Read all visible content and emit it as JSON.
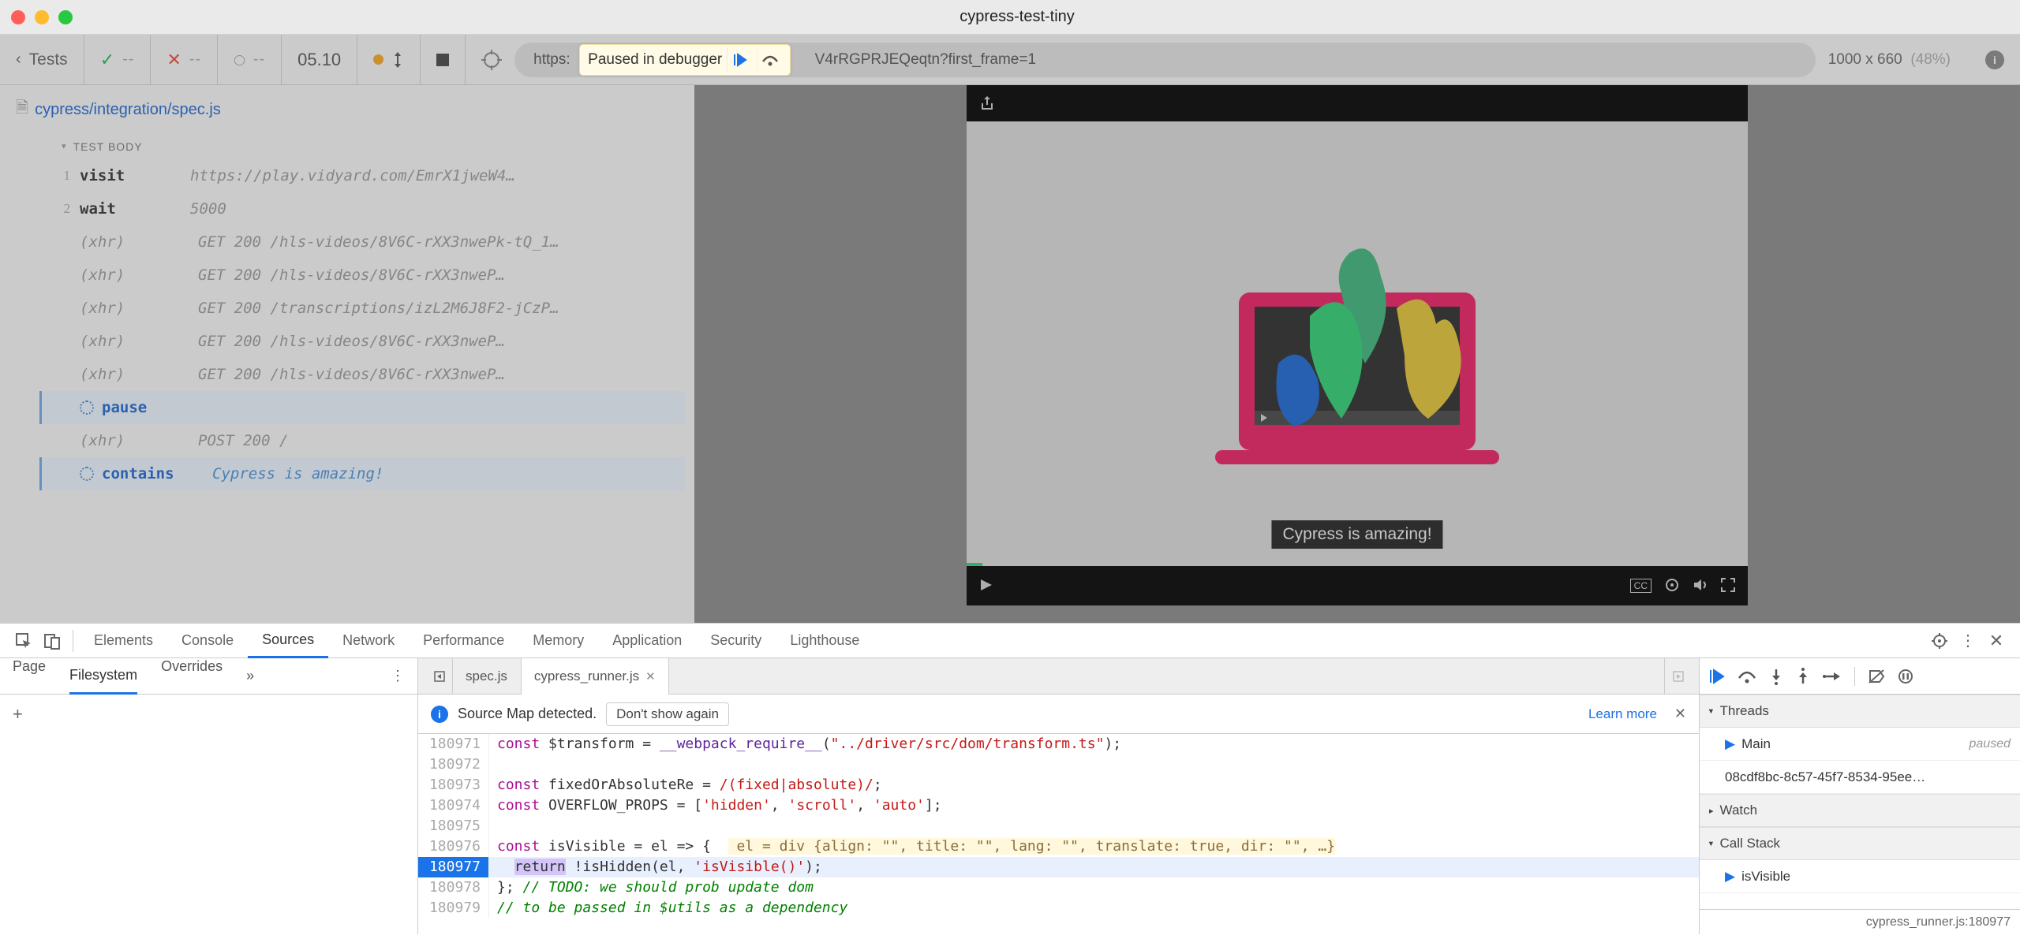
{
  "window": {
    "title": "cypress-test-tiny"
  },
  "toolbar": {
    "back_label": "Tests",
    "pass": "--",
    "fail": "--",
    "pending": "--",
    "timer": "05.10",
    "paused_label": "Paused in debugger",
    "url_prefix": "https:",
    "url_suffix": "V4rRGPRJEQeqtn?first_frame=1",
    "viewport": "1000 x 660",
    "viewport_pct": "(48%)"
  },
  "spec": {
    "path": "cypress/integration/spec.js",
    "test_body_label": "TEST BODY"
  },
  "commands": [
    {
      "num": "1",
      "name": "visit",
      "type": "cmd",
      "msg": "https://play.vidyard.com/EmrX1jweW4…"
    },
    {
      "num": "2",
      "name": "wait",
      "type": "cmd",
      "msg": "5000"
    },
    {
      "num": "",
      "name": "(xhr)",
      "type": "xhr",
      "dot": true,
      "msg": "GET 200 /hls-videos/8V6C-rXX3nwePk-tQ_1…"
    },
    {
      "num": "",
      "name": "(xhr)",
      "type": "xhr",
      "dot": true,
      "msg": "GET 200 /hls-videos/8V6C-rXX3nweP…"
    },
    {
      "num": "",
      "name": "(xhr)",
      "type": "xhr",
      "dot": true,
      "msg": "GET 200 /transcriptions/izL2M6J8F2-jCzP…"
    },
    {
      "num": "",
      "name": "(xhr)",
      "type": "xhr",
      "dot": true,
      "msg": "GET 200 /hls-videos/8V6C-rXX3nweP…"
    },
    {
      "num": "",
      "name": "(xhr)",
      "type": "xhr",
      "dot": true,
      "msg": "GET 200 /hls-videos/8V6C-rXX3nweP…"
    },
    {
      "num": "",
      "name": "pause",
      "type": "blue",
      "spin": true,
      "msg": "",
      "active": true
    },
    {
      "num": "",
      "name": "(xhr)",
      "type": "xhr",
      "dot": true,
      "msg": "POST 200 /"
    },
    {
      "num": "",
      "name": "contains",
      "type": "blue",
      "spin": true,
      "msg": "Cypress is amazing!",
      "msgblue": true,
      "active": true
    }
  ],
  "video": {
    "subtitle": "Cypress is amazing!"
  },
  "devtools": {
    "main_tabs": [
      "Elements",
      "Console",
      "Sources",
      "Network",
      "Performance",
      "Memory",
      "Application",
      "Security",
      "Lighthouse"
    ],
    "main_active": "Sources",
    "nav_subtabs": [
      "Page",
      "Filesystem",
      "Overrides"
    ],
    "nav_active": "Filesystem",
    "nav_more": "»",
    "code_tabs": [
      {
        "label": "spec.js",
        "active": false
      },
      {
        "label": "cypress_runner.js",
        "active": true,
        "closeable": true
      }
    ],
    "src_info": "Source Map detected.",
    "dont_show": "Don't show again",
    "learn_more": "Learn more",
    "code_lines": [
      {
        "n": "180971",
        "html": "<span class='kw'>const</span> $transform = <span class='fn'>__webpack_require__</span>(<span class='str'>\"../driver/src/dom/transform.ts\"</span>);"
      },
      {
        "n": "180972",
        "html": ""
      },
      {
        "n": "180973",
        "html": "<span class='kw'>const</span> fixedOrAbsoluteRe = <span class='str'>/(fixed|absolute)/</span>;"
      },
      {
        "n": "180974",
        "html": "<span class='kw'>const</span> OVERFLOW_PROPS = [<span class='str'>'hidden'</span>, <span class='str'>'scroll'</span>, <span class='str'>'auto'</span>];"
      },
      {
        "n": "180975",
        "html": ""
      },
      {
        "n": "180976",
        "html": "<span class='kw'>const</span> isVisible = el =&gt; {  <span class='inline-obj'> el = div {align: \"\", title: \"\", lang: \"\", translate: true, dir: \"\", …}</span>"
      },
      {
        "n": "180977",
        "html": "  <span class='ret-hl'>return</span> !isHidden(el, <span class='str'>'isVisible()'</span>);",
        "hl": true,
        "bp": true
      },
      {
        "n": "180978",
        "html": "}; <span class='cmt'>// TODO: we should prob update dom</span>"
      },
      {
        "n": "180979",
        "html": "<span class='cmt'>// to be passed in $utils as a dependency</span>"
      }
    ],
    "sidebar": {
      "threads_label": "Threads",
      "threads": [
        {
          "name": "Main",
          "tag": "paused",
          "arrow": true
        },
        {
          "name": "08cdf8bc-8c57-45f7-8534-95ee…"
        }
      ],
      "watch_label": "Watch",
      "callstack_label": "Call Stack",
      "callstack": [
        {
          "name": "isVisible",
          "arrow": true
        }
      ],
      "footer": "cypress_runner.js:180977"
    }
  }
}
